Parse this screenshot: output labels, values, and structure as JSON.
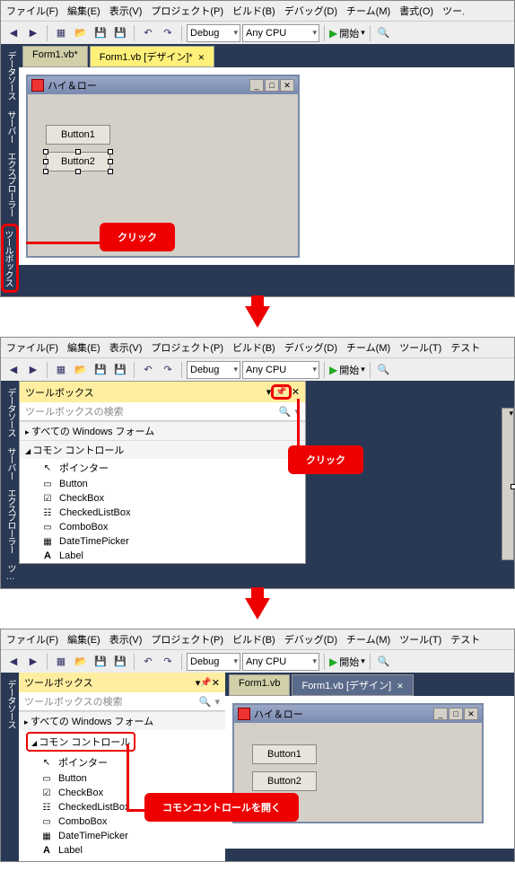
{
  "menu": {
    "file": "ファイル(F)",
    "edit": "編集(E)",
    "view": "表示(V)",
    "project": "プロジェクト(P)",
    "build": "ビルド(B)",
    "debug": "デバッグ(D)",
    "team": "チーム(M)",
    "format": "書式(O)",
    "tool": "ツール(T)",
    "test": "テスト"
  },
  "toolbar": {
    "config": "Debug",
    "platform": "Any CPU",
    "start": "開始"
  },
  "sidetabs": {
    "datasource": "データソース",
    "server": "サーバー エクスプローラー",
    "toolbox": "ツールボックス",
    "toolbox_short": "ツ…"
  },
  "tabs": {
    "code": "Form1.vb*",
    "design": "Form1.vb [デザイン]*",
    "design2": "Form1.vb [デザイン]",
    "code2": "Form1.vb"
  },
  "form": {
    "title": "ハイ＆ロー",
    "button1": "Button1",
    "button2": "Button2"
  },
  "callouts": {
    "click": "クリック",
    "open_common": "コモンコントロールを開く"
  },
  "toolbox": {
    "title": "ツールボックス",
    "search": "ツールボックスの検索",
    "cat_allwin": "すべての Windows フォーム",
    "cat_common": "コモン コントロール",
    "items": {
      "pointer": "ポインター",
      "button": "Button",
      "checkbox": "CheckBox",
      "checkedlistbox": "CheckedListBox",
      "combobox": "ComboBox",
      "datetimepicker": "DateTimePicker",
      "label": "Label"
    }
  }
}
